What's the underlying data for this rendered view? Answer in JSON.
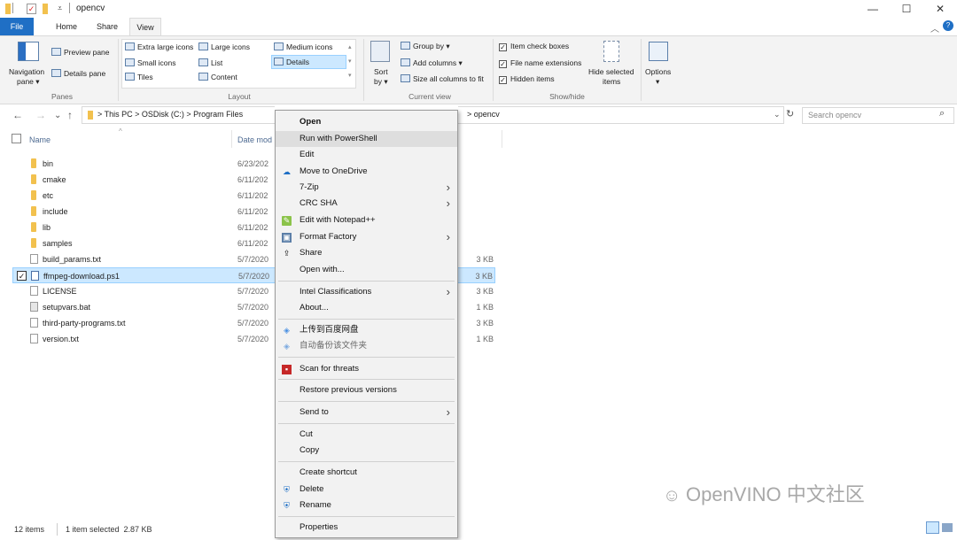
{
  "window": {
    "title": "opencv",
    "controls": [
      "—",
      "☐",
      "✕"
    ]
  },
  "tabs": [
    "File",
    "Home",
    "Share",
    "View"
  ],
  "ribbon": {
    "panes": {
      "navigation": "Navigation",
      "navigation2": "pane ▾",
      "preview": "Preview pane",
      "details": "Details pane",
      "group": "Panes"
    },
    "layout": {
      "items": [
        "Extra large icons",
        "Large icons",
        "Medium icons",
        "Small icons",
        "List",
        "Details",
        "Tiles",
        "Content"
      ],
      "group": "Layout"
    },
    "current_view": {
      "sort": "Sort",
      "sort2": "by ▾",
      "group_by": "Group by ▾",
      "add_columns": "Add columns ▾",
      "size_all": "Size all columns to fit",
      "group": "Current view"
    },
    "show_hide": {
      "item_check_boxes": "Item check boxes",
      "file_name_extensions": "File name extensions",
      "hidden_items": "Hidden items",
      "hide_selected": "Hide selected",
      "hide_selected2": "items",
      "group": "Show/hide"
    },
    "options": "Options",
    "options2": "▾"
  },
  "address": {
    "back": "←",
    "forward": "→",
    "recent": "⌄",
    "up": "↑",
    "crumb_left": "> This PC > OSDisk (C:) > Program Files",
    "crumb_right": "> opencv",
    "refresh": "↻",
    "search_placeholder": "Search opencv"
  },
  "columns": {
    "name": "Name",
    "date": "Date mod"
  },
  "files": [
    {
      "name": "bin",
      "date": "6/23/202",
      "size": "",
      "type": "folder"
    },
    {
      "name": "cmake",
      "date": "6/11/202",
      "size": "",
      "type": "folder"
    },
    {
      "name": "etc",
      "date": "6/11/202",
      "size": "",
      "type": "folder"
    },
    {
      "name": "include",
      "date": "6/11/202",
      "size": "",
      "type": "folder"
    },
    {
      "name": "lib",
      "date": "6/11/202",
      "size": "",
      "type": "folder"
    },
    {
      "name": "samples",
      "date": "6/11/202",
      "size": "",
      "type": "folder"
    },
    {
      "name": "build_params.txt",
      "date": "5/7/2020",
      "size": "3 KB",
      "type": "doc"
    },
    {
      "name": "ffmpeg-download.ps1",
      "date": "5/7/2020",
      "size": "3 KB",
      "type": "doc"
    },
    {
      "name": "LICENSE",
      "date": "5/7/2020",
      "size": "3 KB",
      "type": "doc"
    },
    {
      "name": "setupvars.bat",
      "date": "5/7/2020",
      "size": "1 KB",
      "type": "doc"
    },
    {
      "name": "third-party-programs.txt",
      "date": "5/7/2020",
      "size": "3 KB",
      "type": "doc"
    },
    {
      "name": "version.txt",
      "date": "5/7/2020",
      "size": "1 KB",
      "type": "doc"
    }
  ],
  "status": {
    "count": "12 items",
    "selected": "1 item selected  2.87 KB"
  },
  "context_menu": {
    "open": "Open",
    "run_ps": "Run with PowerShell",
    "edit": "Edit",
    "onedrive": "Move to OneDrive",
    "zip": "7-Zip",
    "crc": "CRC SHA",
    "notepad": "Edit with Notepad++",
    "format_factory": "Format Factory",
    "share": "Share",
    "open_with": "Open with...",
    "intel": "Intel Classifications",
    "about": "About...",
    "baidu_upload": "上传到百度网盘",
    "baidu_backup": "自动备份该文件夹",
    "scan": "Scan for threats",
    "restore": "Restore previous versions",
    "send_to": "Send to",
    "cut": "Cut",
    "copy": "Copy",
    "create_shortcut": "Create shortcut",
    "delete": "Delete",
    "rename": "Rename",
    "properties": "Properties"
  },
  "watermark": "OpenVINO 中文社区",
  "colors": {
    "accent": "#1f6fc5",
    "selection": "#cce8ff",
    "folder": "#f2c14e"
  }
}
